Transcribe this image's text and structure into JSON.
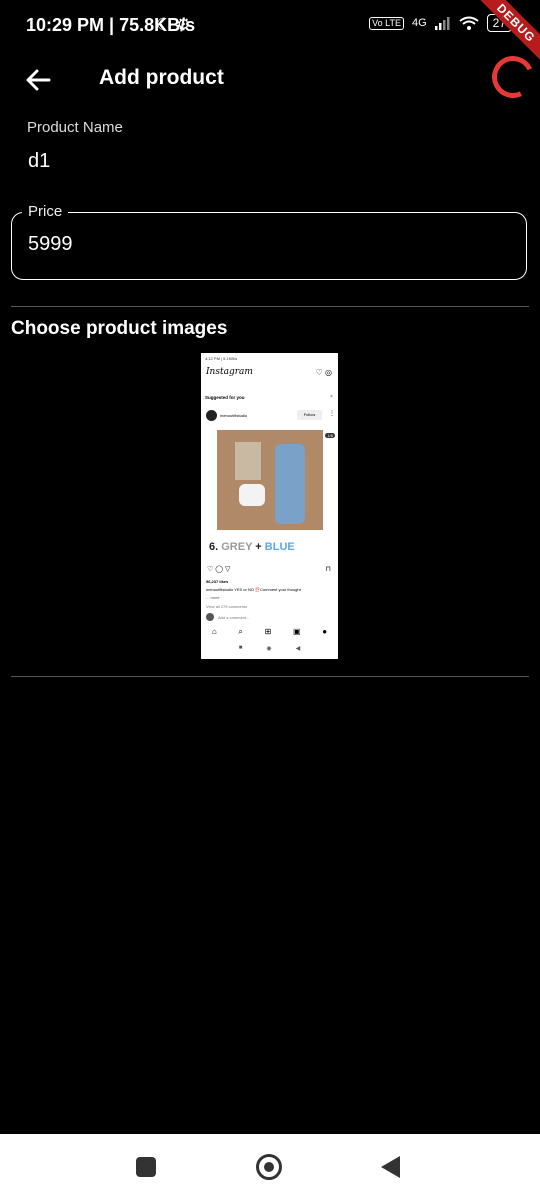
{
  "status_bar": {
    "time": "10:29 PM | 75.8KB/s",
    "left_icons": "☾ ⚙",
    "network": "4G",
    "volte": "Vo LTE",
    "battery": "27",
    "debug_banner": "DEBUG"
  },
  "app_bar": {
    "title": "Add product",
    "back_icon": "arrow-left-icon"
  },
  "form": {
    "product_name_label": "Product Name",
    "product_name_value": "d1",
    "price_label": "Price",
    "price_value": "5999"
  },
  "images_section": {
    "title": "Choose product images"
  },
  "thumbnail": {
    "status": "4:12 PM | 5.1KB/s",
    "logo": "Instagram",
    "suggested": "Suggested for you",
    "username": "menoutfitstudio",
    "follow": "Follow",
    "badge": "1/8",
    "banner_num": "6.",
    "banner_grey": "GREY",
    "banner_plus": "+",
    "banner_blue": "BLUE",
    "likes": "56,237 likes",
    "caption": "menoutfitstudio YES or NO ⁉️Comment your thought",
    "caption_more": "... more",
    "comments": "View all 279 comments",
    "add_comment": "Add a comment..."
  },
  "colors": {
    "background": "#000000",
    "spinner": "#e53935",
    "debug_ribbon": "#b71c1c",
    "nav_bar": "#ffffff"
  }
}
